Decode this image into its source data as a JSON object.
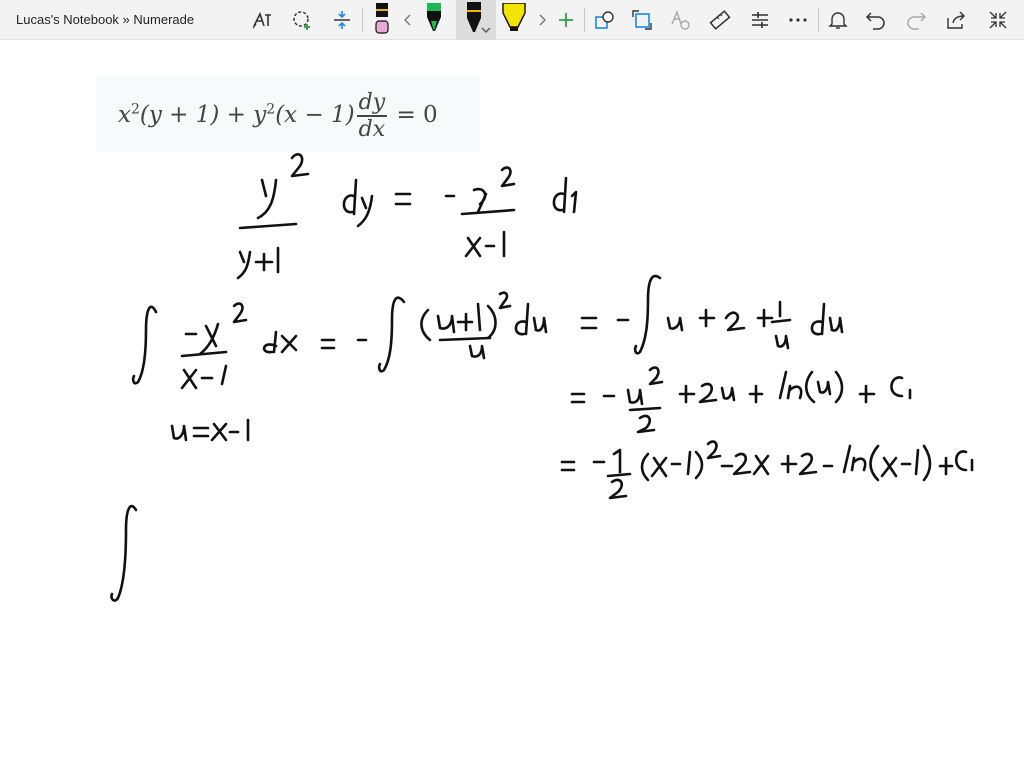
{
  "header": {
    "title": "Lucas's Notebook » Numerade",
    "tools": [
      {
        "name": "ink-to-text-icon"
      },
      {
        "name": "lasso-select-icon"
      },
      {
        "name": "add-space-icon"
      },
      {
        "name": "ink-to-shape-icon"
      },
      {
        "name": "undo-icon"
      },
      {
        "name": "redo-icon"
      },
      {
        "name": "share-icon"
      },
      {
        "name": "fullscreen-icon"
      }
    ],
    "pens": [
      {
        "name": "pen-pink",
        "color": "#e9a9d6"
      },
      {
        "name": "pen-green",
        "color": "#1db954"
      },
      {
        "name": "pen-black",
        "color": "#111111"
      },
      {
        "name": "highlighter-yellow",
        "color": "#f2e300"
      }
    ],
    "accent_color": "#1e88e5"
  },
  "equation": {
    "lhs_a": "x",
    "exp_a": "2",
    "lhs_b": "(y + 1) + y",
    "exp_b": "2",
    "lhs_c": "(x − 1)",
    "frac_num": "dy",
    "frac_den": "dx",
    "rhs": "= 0"
  }
}
